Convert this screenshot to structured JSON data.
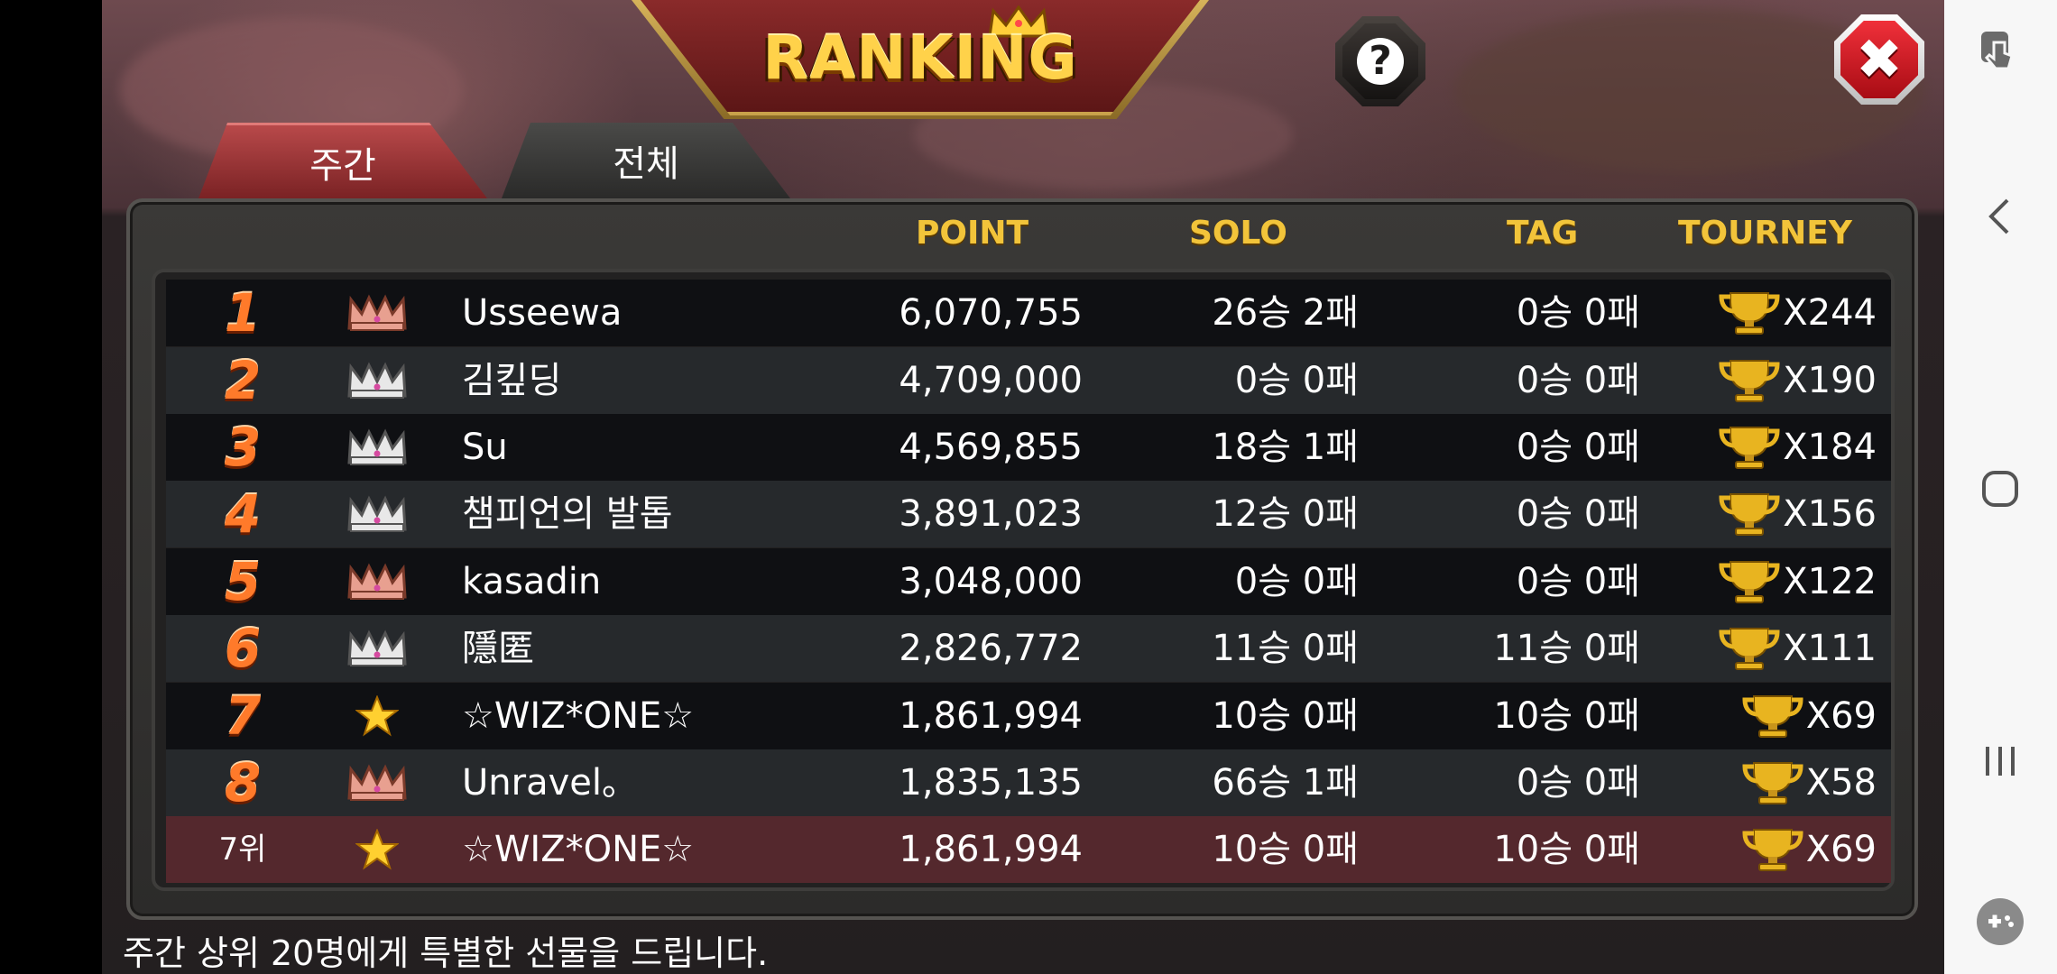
{
  "header": {
    "title": "RANKING",
    "help_glyph": "?",
    "close_glyph": "✖"
  },
  "tabs": [
    {
      "label": "주간",
      "active": true
    },
    {
      "label": "전체",
      "active": false
    }
  ],
  "table": {
    "columns": {
      "point": "POINT",
      "solo": "SOLO",
      "tag": "TAG",
      "tourney": "TOURNEY"
    },
    "rows": [
      {
        "rank": "1",
        "badge": "bronze-crown-icon",
        "name": "Usseewa",
        "point": "6,070,755",
        "solo": "26승 2패",
        "tag": "0승 0패",
        "tourney": "X244"
      },
      {
        "rank": "2",
        "badge": "silver-crown-icon",
        "name": "김킾딩",
        "point": "4,709,000",
        "solo": "0승 0패",
        "tag": "0승 0패",
        "tourney": "X190"
      },
      {
        "rank": "3",
        "badge": "silver-crown-icon",
        "name": "Su",
        "point": "4,569,855",
        "solo": "18승 1패",
        "tag": "0승 0패",
        "tourney": "X184"
      },
      {
        "rank": "4",
        "badge": "silver-crown-icon",
        "name": "챔피언의 발톱",
        "point": "3,891,023",
        "solo": "12승 0패",
        "tag": "0승 0패",
        "tourney": "X156"
      },
      {
        "rank": "5",
        "badge": "bronze-crown-icon",
        "name": "kasadin",
        "point": "3,048,000",
        "solo": "0승 0패",
        "tag": "0승 0패",
        "tourney": "X122"
      },
      {
        "rank": "6",
        "badge": "silver-crown-icon",
        "name": "隱匿",
        "point": "2,826,772",
        "solo": "11승 0패",
        "tag": "11승 0패",
        "tourney": "X111"
      },
      {
        "rank": "7",
        "badge": "star-icon",
        "name": "☆WIZ*ONE☆",
        "point": "1,861,994",
        "solo": "10승 0패",
        "tag": "10승 0패",
        "tourney": "X69"
      },
      {
        "rank": "8",
        "badge": "bronze-crown-icon",
        "name": "Unravel。",
        "point": "1,835,135",
        "solo": "66승 1패",
        "tag": "0승 0패",
        "tourney": "X58"
      }
    ],
    "my_row": {
      "rank": "7위",
      "badge": "star-icon",
      "name": "☆WIZ*ONE☆",
      "point": "1,861,994",
      "solo": "10승 0패",
      "tag": "10승 0패",
      "tourney": "X69"
    }
  },
  "footer": {
    "note": "주간 상위 20명에게 특별한 선물을 드립니다."
  },
  "colors": {
    "accent_gold": "#f2c43a",
    "rank_orange": "#ff7a2a",
    "tab_active": "#b8494a",
    "my_row": "#54282d",
    "close_red": "#e0202a"
  },
  "system_nav": [
    "touch-assist-icon",
    "back-icon",
    "home-icon",
    "recents-icon",
    "game-tools-icon"
  ]
}
